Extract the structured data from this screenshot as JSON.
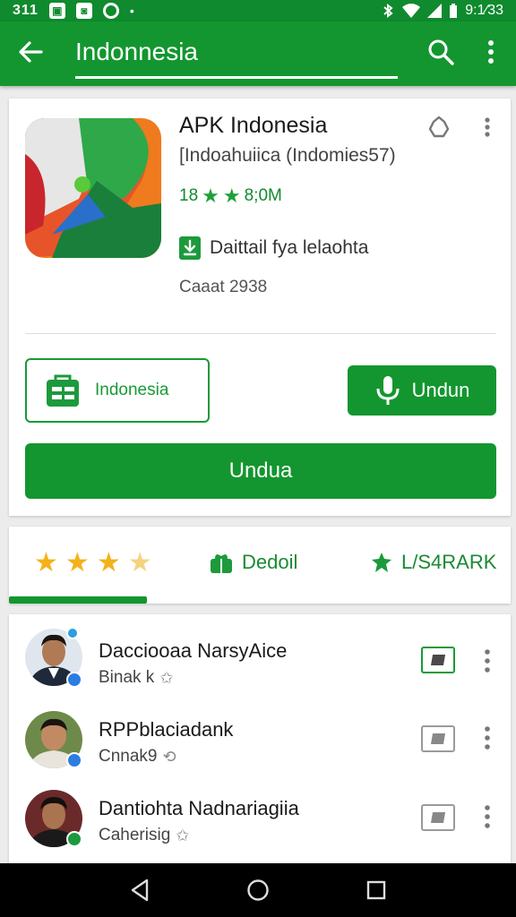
{
  "status_bar": {
    "time_left": "311",
    "time_right": "9:1⁄33"
  },
  "app_bar": {
    "title": "Indonnesia"
  },
  "app": {
    "name": "APK Indonesia",
    "subtitle": "[Indoahuiica (Indomies57)",
    "rating_prefix": "18",
    "rating_suffix": "8;0M",
    "download_label": "Daittail fya lelaohta",
    "date": "Caaat 2938",
    "primary_button": "Indonesia",
    "secondary_button": "Undun",
    "wide_button": "Undua"
  },
  "tabs": [
    {
      "label": ""
    },
    {
      "label": "Dedoil"
    },
    {
      "label": "L/S4RARK"
    }
  ],
  "users": [
    {
      "name": "Dacciooaa NarsyAice",
      "sub": "Binak k",
      "sub_icon": "✩",
      "msg_active": true,
      "badge_color": "#2b7de0"
    },
    {
      "name": "RPPblaciadank",
      "sub": "Cnnak9",
      "sub_icon": "⟲",
      "msg_active": false,
      "badge_color": "#2b7de0"
    },
    {
      "name": "Dantiohta Nadnariagiia",
      "sub": "Caherisig",
      "sub_icon": "✩",
      "msg_active": false,
      "badge_color": "#1c9a3c"
    }
  ],
  "colors": {
    "primary": "#13962f",
    "status_bar": "#108a2e",
    "star": "#f3b21b"
  }
}
